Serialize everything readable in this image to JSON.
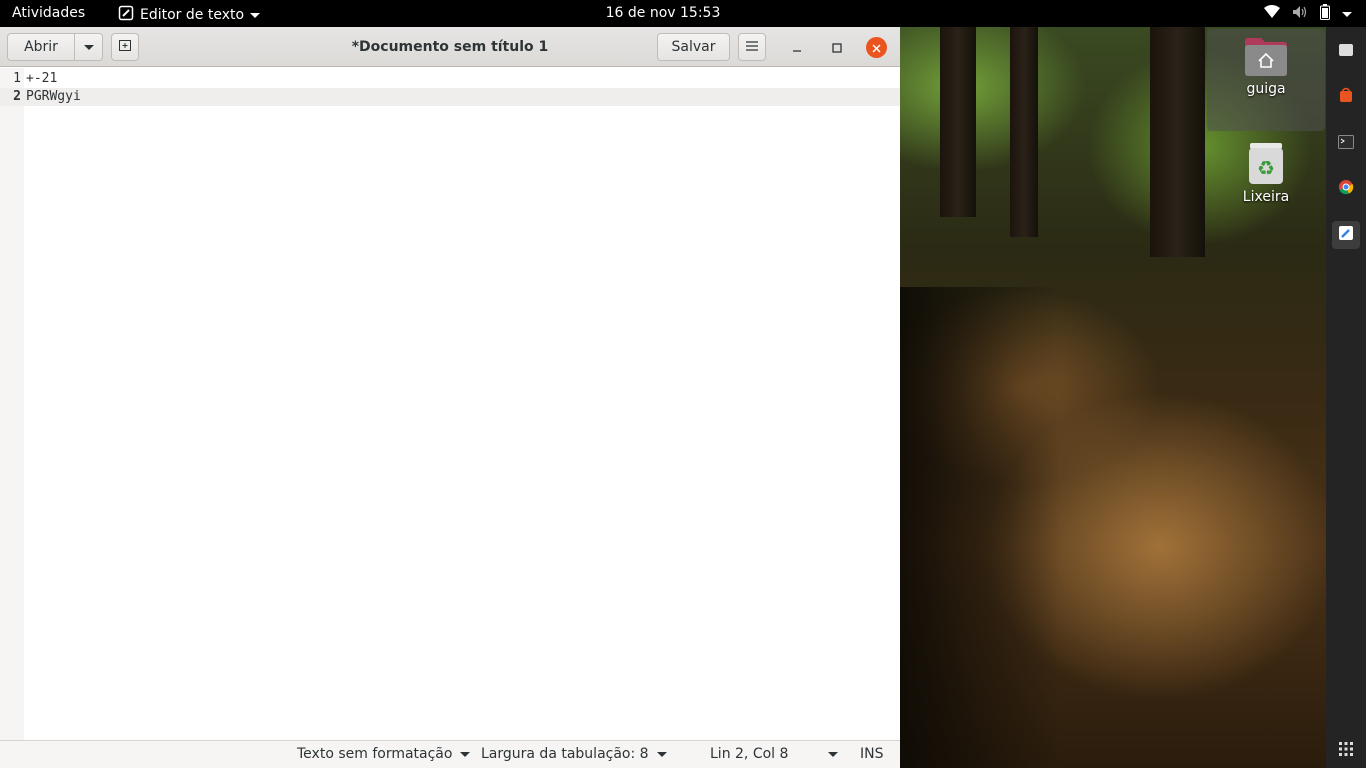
{
  "topbar": {
    "activities": "Atividades",
    "app_name": "Editor de texto",
    "clock": "16 de nov  15:53"
  },
  "window": {
    "open_label": "Abrir",
    "title": "*Documento sem título 1",
    "save_label": "Salvar"
  },
  "editor": {
    "lines": [
      {
        "number": "1",
        "text": "+-21"
      },
      {
        "number": "2",
        "text": "PGRWgyi"
      }
    ]
  },
  "statusbar": {
    "language": "Texto sem formatação",
    "tab_width": "Largura da tabulação: 8",
    "position": "Lin 2, Col 8",
    "mode": "INS"
  },
  "desktop": {
    "home_label": "guiga",
    "trash_label": "Lixeira"
  },
  "colors": {
    "close_button": "#e9541f",
    "topbar": "#000000",
    "dock": "#242424"
  }
}
